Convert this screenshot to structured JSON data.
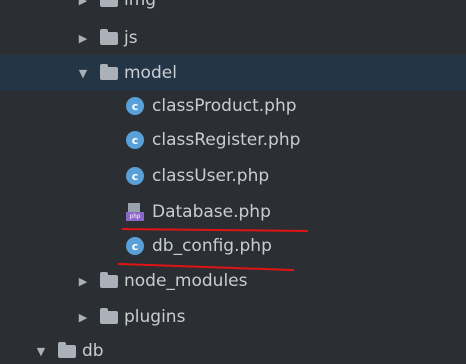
{
  "tree": {
    "items": [
      {
        "label": "img",
        "type": "folder",
        "expanded": false
      },
      {
        "label": "js",
        "type": "folder",
        "expanded": false
      },
      {
        "label": "model",
        "type": "folder",
        "expanded": true
      },
      {
        "label": "classProduct.php",
        "type": "class-file",
        "icon_letter": "c"
      },
      {
        "label": "classRegister.php",
        "type": "class-file",
        "icon_letter": "c"
      },
      {
        "label": "classUser.php",
        "type": "class-file",
        "icon_letter": "c"
      },
      {
        "label": "Database.php",
        "type": "php-file",
        "icon_text": "php"
      },
      {
        "label": "db_config.php",
        "type": "class-file",
        "icon_letter": "c"
      },
      {
        "label": "node_modules",
        "type": "folder",
        "expanded": false
      },
      {
        "label": "plugins",
        "type": "folder",
        "expanded": false
      },
      {
        "label": "db",
        "type": "folder",
        "expanded": true
      }
    ]
  },
  "colors": {
    "background": "#2b2f33",
    "selected_row": "#243546",
    "class_icon": "#5aa0d8",
    "annotation": "#e01414"
  }
}
